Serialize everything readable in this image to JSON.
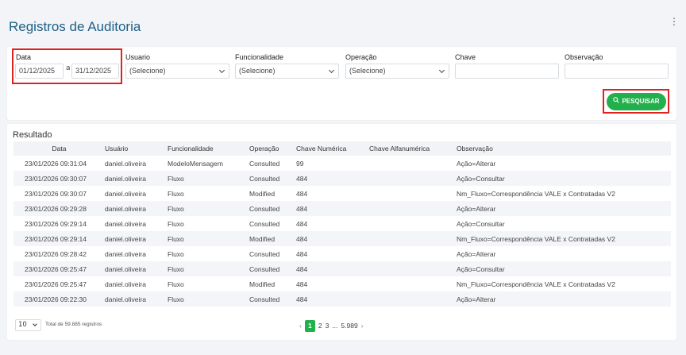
{
  "page": {
    "title": "Registros de Auditoria"
  },
  "filters": {
    "data_label": "Data",
    "date_from": "01/12/2025",
    "date_sep": "a",
    "date_to": "31/12/2025",
    "usuario_label": "Usuario",
    "usuario_value": "(Selecione)",
    "funcionalidade_label": "Funcionalidade",
    "funcionalidade_value": "(Selecione)",
    "operacao_label": "Operação",
    "operacao_value": "(Selecione)",
    "chave_label": "Chave",
    "chave_value": "",
    "observacao_label": "Observação",
    "observacao_value": "",
    "search_button": "PESQUISAR"
  },
  "results": {
    "title": "Resultado",
    "columns": [
      "Data",
      "Usuário",
      "Funcionalidade",
      "Operação",
      "Chave Numérica",
      "Chave Alfanumérica",
      "Observação"
    ],
    "rows": [
      [
        "23/01/2026 09:31:04",
        "daniel.oliveira",
        "ModeloMensagem",
        "Consulted",
        "99",
        "",
        "Ação=Alterar"
      ],
      [
        "23/01/2026 09:30:07",
        "daniel.oliveira",
        "Fluxo",
        "Consulted",
        "484",
        "",
        "Ação=Consultar"
      ],
      [
        "23/01/2026 09:30:07",
        "daniel.oliveira",
        "Fluxo",
        "Modified",
        "484",
        "",
        "Nm_Fluxo=Correspondência VALE x Contratadas V2"
      ],
      [
        "23/01/2026 09:29:28",
        "daniel.oliveira",
        "Fluxo",
        "Consulted",
        "484",
        "",
        "Ação=Alterar"
      ],
      [
        "23/01/2026 09:29:14",
        "daniel.oliveira",
        "Fluxo",
        "Consulted",
        "484",
        "",
        "Ação=Consultar"
      ],
      [
        "23/01/2026 09:29:14",
        "daniel.oliveira",
        "Fluxo",
        "Modified",
        "484",
        "",
        "Nm_Fluxo=Correspondência VALE x Contratadas V2"
      ],
      [
        "23/01/2026 09:28:42",
        "daniel.oliveira",
        "Fluxo",
        "Consulted",
        "484",
        "",
        "Ação=Alterar"
      ],
      [
        "23/01/2026 09:25:47",
        "daniel.oliveira",
        "Fluxo",
        "Consulted",
        "484",
        "",
        "Ação=Consultar"
      ],
      [
        "23/01/2026 09:25:47",
        "daniel.oliveira",
        "Fluxo",
        "Modified",
        "484",
        "",
        "Nm_Fluxo=Correspondência VALE x Contratadas V2"
      ],
      [
        "23/01/2026 09:22:30",
        "daniel.oliveira",
        "Fluxo",
        "Consulted",
        "484",
        "",
        "Ação=Alterar"
      ]
    ]
  },
  "pagination": {
    "page_size": "10",
    "total_text": "Total de 59.885 registros",
    "prev": "‹",
    "pages": [
      "1",
      "2",
      "3"
    ],
    "ellipsis": "...",
    "last": "5.989",
    "next": "›"
  },
  "icons": {
    "menu": "kebab-icon",
    "search": "search-icon"
  },
  "colors": {
    "accent": "#21b04b",
    "title": "#1f5f86",
    "highlight": "#e32020"
  }
}
